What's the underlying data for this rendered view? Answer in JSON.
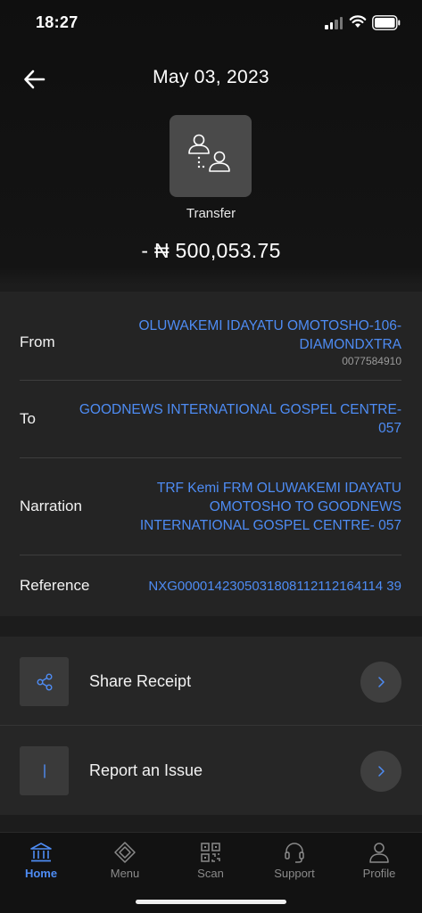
{
  "status_bar": {
    "time": "18:27"
  },
  "header": {
    "date": "May 03, 2023",
    "transaction_type": "Transfer",
    "amount": "- ₦ 500,053.75"
  },
  "details": {
    "from": {
      "label": "From",
      "value": "OLUWAKEMI IDAYATU OMOTOSHO-106-DIAMONDXTRA",
      "account": "0077584910"
    },
    "to": {
      "label": "To",
      "value": "GOODNEWS INTERNATIONAL GOSPEL CENTRE-057"
    },
    "narration": {
      "label": "Narration",
      "value": "TRF Kemi FRM OLUWAKEMI IDAYATU OMOTOSHO TO GOODNEWS INTERNATIONAL GOSPEL CENTRE- 057"
    },
    "reference": {
      "label": "Reference",
      "value": "NXG0000142305031808112112164114 39"
    }
  },
  "actions": [
    {
      "label": "Share Receipt",
      "icon": "share-icon"
    },
    {
      "label": "Report an Issue",
      "icon": "info-icon"
    }
  ],
  "nav": [
    {
      "label": "Home",
      "icon": "bank-icon",
      "active": true
    },
    {
      "label": "Menu",
      "icon": "menu-icon",
      "active": false
    },
    {
      "label": "Scan",
      "icon": "qr-icon",
      "active": false
    },
    {
      "label": "Support",
      "icon": "headset-icon",
      "active": false
    },
    {
      "label": "Profile",
      "icon": "person-icon",
      "active": false
    }
  ],
  "colors": {
    "accent": "#4e8cf4",
    "background": "#1c1c1c",
    "card": "#242424"
  }
}
